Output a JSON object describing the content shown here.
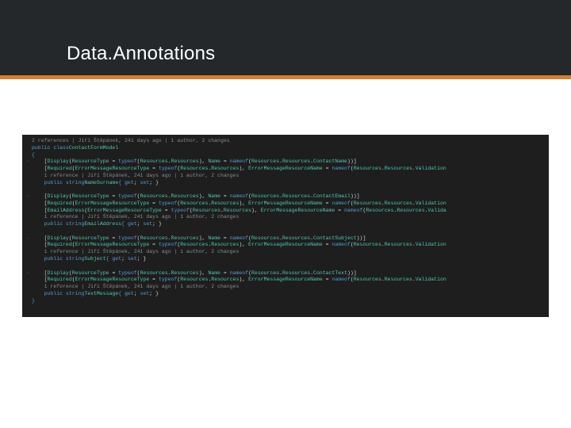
{
  "title": "Data.Annotations",
  "code": {
    "lens_class": "2 references | Jiří Štěpánek, 241 days ago | 1 author, 2 changes",
    "decl_class": [
      "public class",
      "ContactFormModel"
    ],
    "brace_open": "{",
    "attr_name_display": [
      "[",
      "Display",
      "(",
      "ResourceType",
      " = ",
      "typeof",
      "(",
      "Resources",
      ".",
      "Resources",
      "), ",
      "Name",
      " = ",
      "nameof",
      "(",
      "Resources",
      ".",
      "Resources",
      ".",
      "ContactName",
      "))]"
    ],
    "attr_name_required": [
      "[",
      "Required",
      "(",
      "ErrorMessageResourceType",
      " = ",
      "typeof",
      "(",
      "Resources",
      ".",
      "Resources",
      "), ",
      "ErrorMessageResourceName",
      " = ",
      "nameof",
      "(",
      "Resources",
      ".",
      "Resources",
      ".",
      "Validation"
    ],
    "lens_name": "1 reference | Jiří Štěpánek, 241 days ago | 1 author, 2 changes",
    "prop_name": [
      "public string",
      "NameSurname",
      "{ ",
      "get",
      "; ",
      "set",
      "; }"
    ],
    "attr_email_display": [
      "[",
      "Display",
      "(",
      "ResourceType",
      " = ",
      "typeof",
      "(",
      "Resources",
      ".",
      "Resources",
      "), ",
      "Name",
      " = ",
      "nameof",
      "(",
      "Resources",
      ".",
      "Resources",
      ".",
      "ContactEmail",
      "))]"
    ],
    "attr_email_required": [
      "[",
      "Required",
      "(",
      "ErrorMessageResourceType",
      " = ",
      "typeof",
      "(",
      "Resources",
      ".",
      "Resources",
      "), ",
      "ErrorMessageResourceName",
      " = ",
      "nameof",
      "(",
      "Resources",
      ".",
      "Resources",
      ".",
      "Validation"
    ],
    "attr_email_email": [
      "[",
      "EmailAddress",
      "(",
      "ErrorMessageResourceType",
      " = ",
      "typeof",
      "(",
      "Resources",
      ".",
      "Resources",
      "), ",
      "ErrorMessageResourceName",
      " = ",
      "nameof",
      "(",
      "Resources",
      ".",
      "Resources",
      ".",
      "Valida"
    ],
    "lens_email": "1 reference | Jiří Štěpánek, 241 days ago | 1 author, 2 changes",
    "prop_email": [
      "public string",
      "EmailAddress",
      "{ ",
      "get",
      "; ",
      "set",
      "; }"
    ],
    "attr_subj_display": [
      "[",
      "Display",
      "(",
      "ResourceType",
      " = ",
      "typeof",
      "(",
      "Resources",
      ".",
      "Resources",
      "), ",
      "Name",
      " = ",
      "nameof",
      "(",
      "Resources",
      ".",
      "Resources",
      ".",
      "ContactSubject",
      "))]"
    ],
    "attr_subj_required": [
      "[",
      "Required",
      "(",
      "ErrorMessageResourceType",
      " = ",
      "typeof",
      "(",
      "Resources",
      ".",
      "Resources",
      "), ",
      "ErrorMessageResourceName",
      " = ",
      "nameof",
      "(",
      "Resources",
      ".",
      "Resources",
      ".",
      "Validation"
    ],
    "lens_subj": "1 reference | Jiří Štěpánek, 241 days ago | 1 author, 2 changes",
    "prop_subj": [
      "public string",
      "Subject",
      "{ ",
      "get",
      "; ",
      "set",
      "; }"
    ],
    "attr_text_display": [
      "[",
      "Display",
      "(",
      "ResourceType",
      " = ",
      "typeof",
      "(",
      "Resources",
      ".",
      "Resources",
      "), ",
      "Name",
      " = ",
      "nameof",
      "(",
      "Resources",
      ".",
      "Resources",
      ".",
      "ContactText",
      "))]"
    ],
    "attr_text_required": [
      "[",
      "Required",
      "(",
      "ErrorMessageResourceType",
      " = ",
      "typeof",
      "(",
      "Resources",
      ".",
      "Resources",
      "), ",
      "ErrorMessageResourceName",
      " = ",
      "nameof",
      "(",
      "Resources",
      ".",
      "Resources",
      ".",
      "Validation"
    ],
    "lens_text": "1 reference | Jiří Štěpánek, 241 days ago | 1 author, 2 changes",
    "prop_text": [
      "public string",
      "TextMessage",
      "{ ",
      "get",
      "; ",
      "set",
      "; }"
    ],
    "brace_close": "}"
  }
}
